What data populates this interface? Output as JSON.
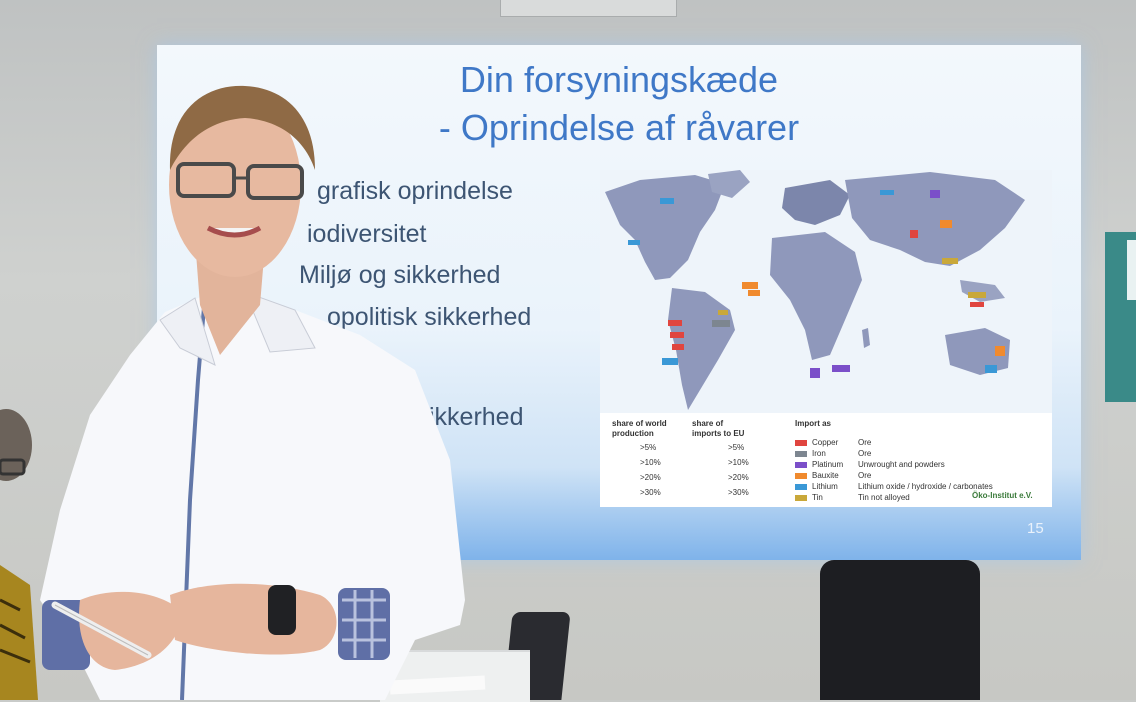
{
  "slide": {
    "title_line1": "Din forsyningskæde",
    "title_line2": "- Oprindelse af råvarer",
    "bullets": [
      "grafisk oprindelse",
      "iodiversitet",
      "Miljø og sikkerhed",
      "opolitisk sikkerhed",
      "ikkerhed"
    ],
    "page_number": "15"
  },
  "map_legend": {
    "col1_header_line1": "share of world",
    "col1_header_line2": "production",
    "col2_header_line1": "share of",
    "col2_header_line2": "imports to EU",
    "col3_header": "Import as",
    "thresholds_world": [
      ">5%",
      ">10%",
      ">20%",
      ">30%"
    ],
    "thresholds_eu": [
      ">5%",
      ">10%",
      ">20%",
      ">30%"
    ],
    "materials": [
      {
        "name": "Copper",
        "form": "Ore",
        "color": "#e0453f"
      },
      {
        "name": "Iron",
        "form": "Ore",
        "color": "#7d8690"
      },
      {
        "name": "Platinum",
        "form": "Unwrought and powders",
        "color": "#7b4fc9"
      },
      {
        "name": "Bauxite",
        "form": "Ore",
        "color": "#f08a2e"
      },
      {
        "name": "Lithium",
        "form": "Lithium oxide / hydroxide / carbonates",
        "color": "#3a98d6"
      },
      {
        "name": "Tin",
        "form": "Tin not alloyed",
        "color": "#c9a83a"
      }
    ],
    "source": "Öko-Institut e.V."
  },
  "colors": {
    "title": "#3f78c7",
    "bullet_text": "#3d5573",
    "land": "#8d96b8",
    "ocean": "#eef4fa"
  }
}
